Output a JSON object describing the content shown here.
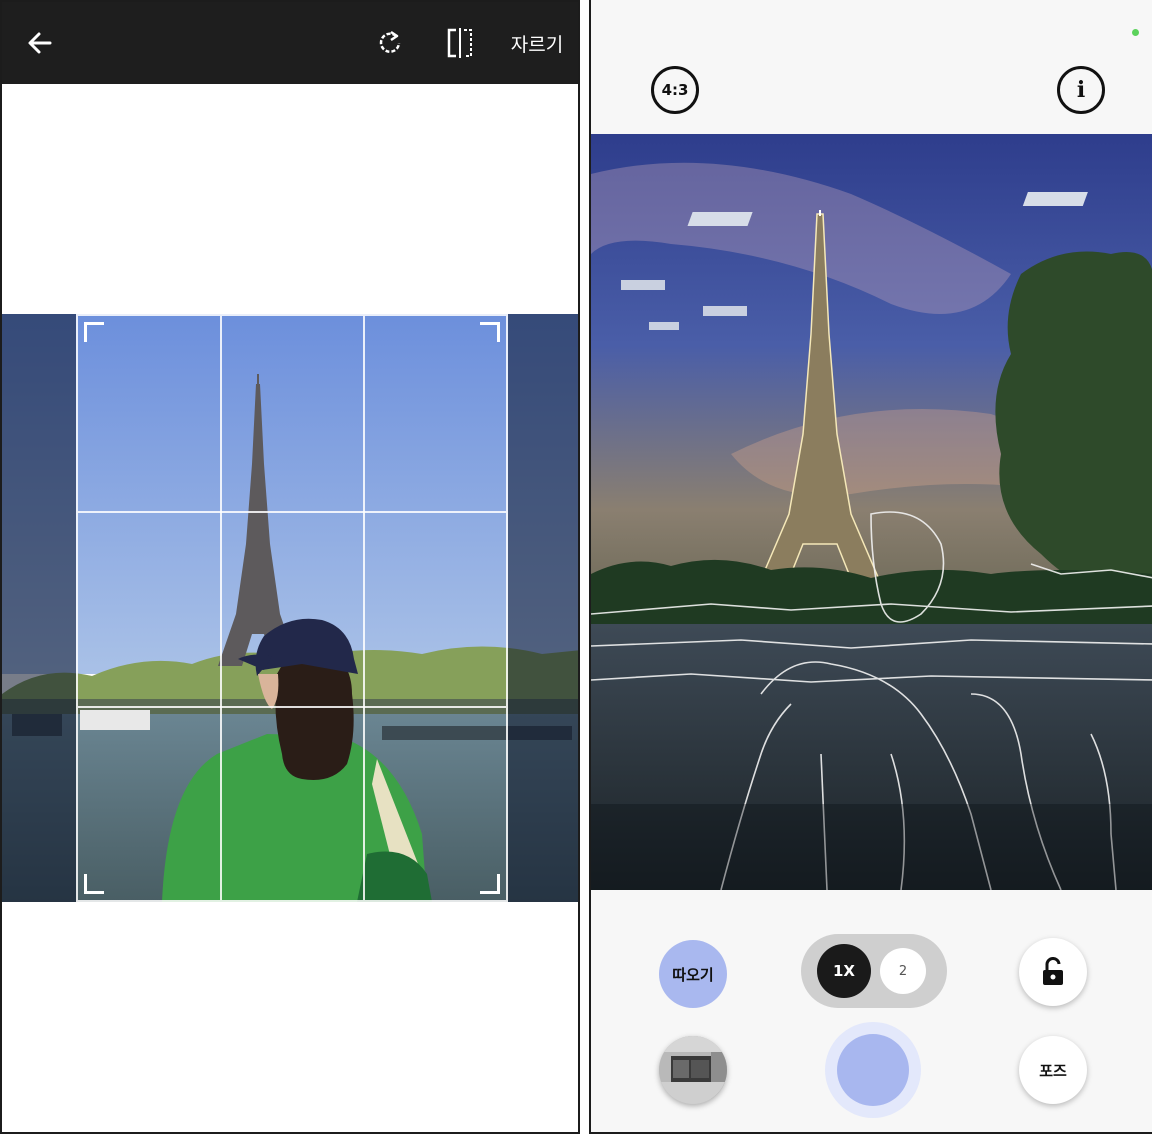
{
  "crop_screen": {
    "toolbar": {
      "back_icon": "arrow-left-icon",
      "rotate_icon": "rotate-icon",
      "flip_icon": "flip-horizontal-icon",
      "crop_label": "자르기"
    }
  },
  "camera_screen": {
    "aspect_ratio_label": "4:3",
    "info_label": "i",
    "trace_label": "따오기",
    "zoom_options": [
      "1X",
      "2"
    ],
    "zoom_selected": "1X",
    "lock_icon": "unlock-icon",
    "pose_label": "포즈",
    "status_indicator_color": "#5bd25b",
    "accent_color": "#a8b7ef"
  }
}
